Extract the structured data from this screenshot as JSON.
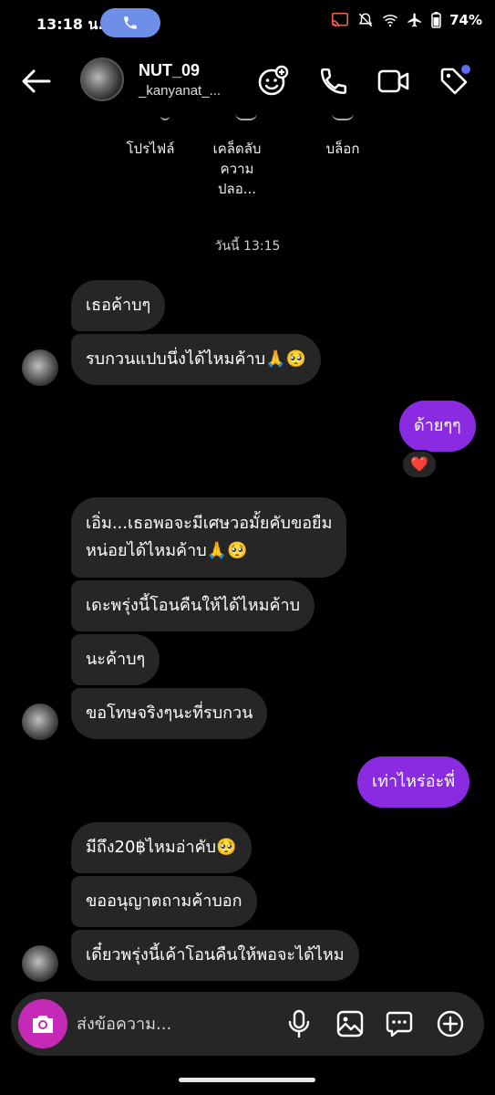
{
  "status_bar": {
    "time": "13:18 น.",
    "battery": "74%"
  },
  "header": {
    "username": "NUT_09",
    "handle": "_kanyanat_..."
  },
  "quick_actions": [
    {
      "label_line1": "โปรไฟล์",
      "label_line2": ""
    },
    {
      "label_line1": "เคล็ดลับ",
      "label_line2": "ความปลอ..."
    },
    {
      "label_line1": "บล็อก",
      "label_line2": ""
    }
  ],
  "date_separator": "วันนี้ 13:15",
  "messages": {
    "m1": "เธอค้าบๆ",
    "m2": "รบกวนแปบนึ่งได้ไหมค้าบ🙏🥺",
    "m3": "ด้ายๆๆ",
    "m3_reaction": "❤️",
    "m4_line1": "เอิ่ม...เธอพอจะมีเศษวอมั้ยคับขอยืม",
    "m4_line2": "หน่อยได้ไหมค้าบ🙏🥺",
    "m5": "เดะพรุ่งนี้โอนคืนให้ได้ไหมค้าบ",
    "m6": "นะค้าบๆ",
    "m7": "ขอโทษจริงๆนะที่รบกวน",
    "m8": "เท่าไหร่อ่ะพี่",
    "m9": "มีถึง20฿ไหมอ่าคับ🥺",
    "m10": "ขออนุญาตถามค้าบอก",
    "m11": "เดี๋ยวพรุ่งนี้เค้าโอนคืนให้พอจะได้ไหม"
  },
  "composer": {
    "placeholder": "ส่งข้อความ..."
  },
  "colors": {
    "outgoing_bubble": "#8a2be2",
    "incoming_bubble": "#262626",
    "camera_button": "#c42ab6",
    "call_pill": "#6d8fe8"
  }
}
